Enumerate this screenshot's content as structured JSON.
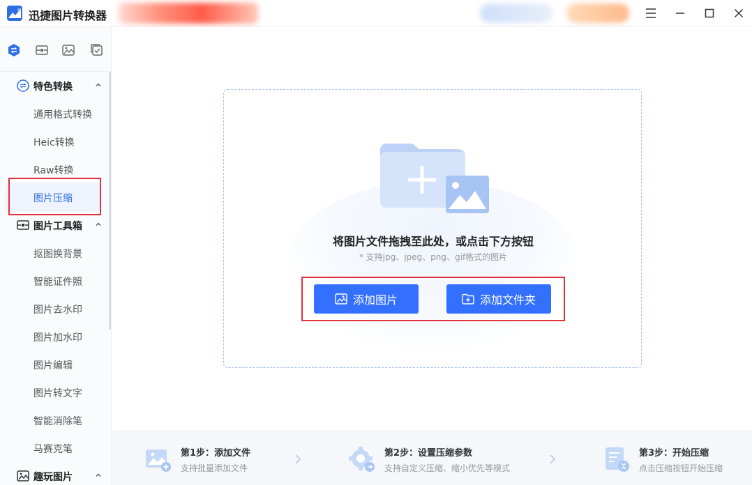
{
  "app": {
    "title": "迅捷图片转换器"
  },
  "window_controls": {
    "menu_icon": "hamburger-icon",
    "minimize_icon": "minimize-icon",
    "maximize_icon": "maximize-icon",
    "close_icon": "close-icon"
  },
  "tabs": [
    {
      "icon": "convert-icon",
      "active": true
    },
    {
      "icon": "toolbox-icon",
      "active": false
    },
    {
      "icon": "image-icon",
      "active": false
    },
    {
      "icon": "checklist-icon",
      "active": false
    }
  ],
  "sidebar": {
    "sections": [
      {
        "label": "特色转换",
        "icon": "convert-icon",
        "items": [
          "通用格式转换",
          "Heic转换",
          "Raw转换",
          "图片压缩"
        ]
      },
      {
        "label": "图片工具箱",
        "icon": "toolbox-icon",
        "items": [
          "抠图换背景",
          "智能证件照",
          "图片去水印",
          "图片加水印",
          "图片编辑",
          "图片转文字",
          "智能消除笔",
          "马赛克笔"
        ]
      },
      {
        "label": "趣玩图片",
        "icon": "fun-image-icon",
        "items": []
      }
    ],
    "active_item": "图片压缩"
  },
  "dropzone": {
    "title": "将图片文件拖拽至此处，或点击下方按钮",
    "subtitle": "* 支持jpg、jpeg、png、gif格式的图片",
    "add_image_label": "添加图片",
    "add_folder_label": "添加文件夹"
  },
  "steps": [
    {
      "title": "第1步：添加文件",
      "desc": "支持批量添加文件",
      "icon": "add-image-icon"
    },
    {
      "title": "第2步：设置压缩参数",
      "desc": "支持自定义压缩、缩小优先等模式",
      "icon": "settings-gear-icon"
    },
    {
      "title": "第3步：开始压缩",
      "desc": "点击压缩按钮开始压缩",
      "icon": "compress-document-icon"
    }
  ],
  "colors": {
    "accent": "#3370ff",
    "brand": "#2f6fe4",
    "highlight_border": "#e0303a",
    "active_bg": "#eef3fd"
  }
}
